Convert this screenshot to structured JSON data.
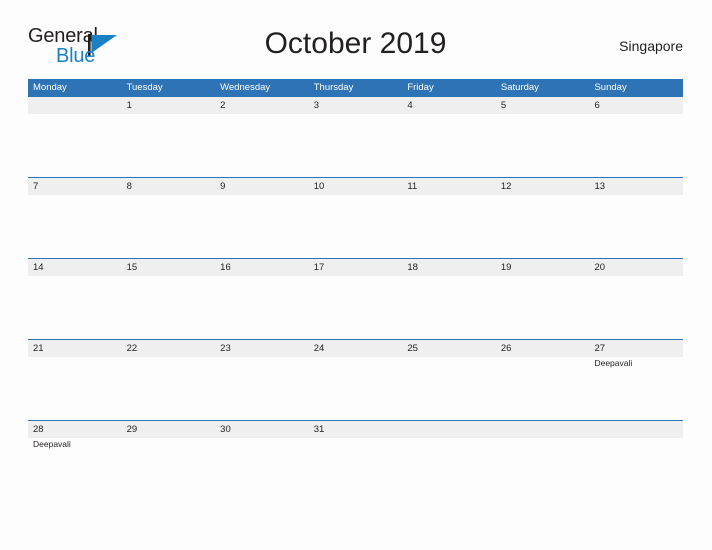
{
  "logo": {
    "word_one": "General",
    "word_two": "Blue",
    "flag_icon": "flag-triangle-icon",
    "blue": "#1a80c4",
    "dark": "#231f20"
  },
  "header": {
    "title": "October 2019",
    "location": "Singapore"
  },
  "colors": {
    "header_blue": "#2e73b5",
    "row_stripe": "#efefef",
    "text": "#231f20",
    "page_background": "#fdfdfd"
  },
  "calendar": {
    "day_headers": [
      "Monday",
      "Tuesday",
      "Wednesday",
      "Thursday",
      "Friday",
      "Saturday",
      "Sunday"
    ],
    "weeks": [
      [
        {
          "date": "",
          "event": ""
        },
        {
          "date": "1",
          "event": ""
        },
        {
          "date": "2",
          "event": ""
        },
        {
          "date": "3",
          "event": ""
        },
        {
          "date": "4",
          "event": ""
        },
        {
          "date": "5",
          "event": ""
        },
        {
          "date": "6",
          "event": ""
        }
      ],
      [
        {
          "date": "7",
          "event": ""
        },
        {
          "date": "8",
          "event": ""
        },
        {
          "date": "9",
          "event": ""
        },
        {
          "date": "10",
          "event": ""
        },
        {
          "date": "11",
          "event": ""
        },
        {
          "date": "12",
          "event": ""
        },
        {
          "date": "13",
          "event": ""
        }
      ],
      [
        {
          "date": "14",
          "event": ""
        },
        {
          "date": "15",
          "event": ""
        },
        {
          "date": "16",
          "event": ""
        },
        {
          "date": "17",
          "event": ""
        },
        {
          "date": "18",
          "event": ""
        },
        {
          "date": "19",
          "event": ""
        },
        {
          "date": "20",
          "event": ""
        }
      ],
      [
        {
          "date": "21",
          "event": ""
        },
        {
          "date": "22",
          "event": ""
        },
        {
          "date": "23",
          "event": ""
        },
        {
          "date": "24",
          "event": ""
        },
        {
          "date": "25",
          "event": ""
        },
        {
          "date": "26",
          "event": ""
        },
        {
          "date": "27",
          "event": "Deepavali"
        }
      ],
      [
        {
          "date": "28",
          "event": "Deepavali"
        },
        {
          "date": "29",
          "event": ""
        },
        {
          "date": "30",
          "event": ""
        },
        {
          "date": "31",
          "event": ""
        },
        {
          "date": "",
          "event": ""
        },
        {
          "date": "",
          "event": ""
        },
        {
          "date": "",
          "event": ""
        }
      ]
    ]
  }
}
